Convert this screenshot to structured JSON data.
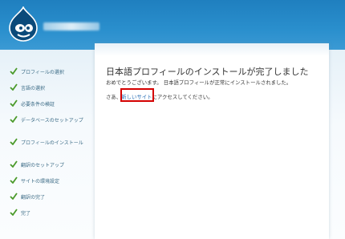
{
  "header": {
    "site_name": "",
    "logo_icon": "drupal-drop-icon"
  },
  "sidebar": {
    "steps": [
      {
        "label": "プロフィールの選択",
        "done": true
      },
      {
        "label": "言語の選択",
        "done": true
      },
      {
        "label": "必要条件の検証",
        "done": true
      },
      {
        "label": "データベースのセットアップ",
        "done": true
      },
      {
        "label": "プロフィールのインストール",
        "done": true
      },
      {
        "label": "翻訳のセットアップ",
        "done": true
      },
      {
        "label": "サイトの環境設定",
        "done": true
      },
      {
        "label": "翻訳の完了",
        "done": true
      },
      {
        "label": "完了",
        "done": true
      }
    ]
  },
  "main": {
    "title": "日本語プロフィールのインストールが完了しました",
    "congrats": "おめでとうございます。 日本語プロフィールが正常にインストールされました。",
    "visit_prefix": "さあ、",
    "link_text": "新しいサイト",
    "visit_suffix": "にアクセスしてください。"
  },
  "colors": {
    "header": "#2a8fcd",
    "check": "#4a9a2a",
    "link": "#2a6fb6",
    "highlight": "#d40000"
  }
}
